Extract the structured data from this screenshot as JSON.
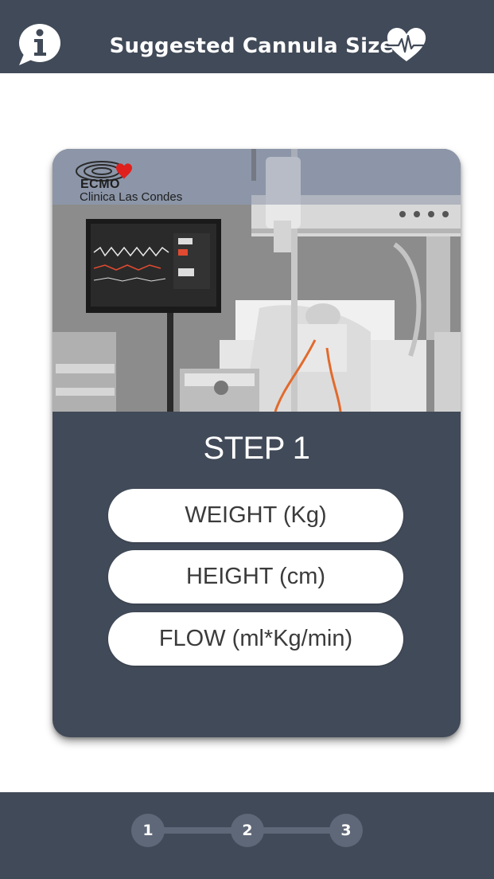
{
  "header": {
    "title": "Suggested Cannula Size",
    "info_icon": "info-icon",
    "heart_icon": "heart-pulse-icon"
  },
  "card": {
    "photo": {
      "logo_ecmo": "ECMO",
      "logo_text": "Clinica Las Condes"
    },
    "step_title": "STEP 1",
    "fields": [
      {
        "label": "WEIGHT (Kg)"
      },
      {
        "label": "HEIGHT (cm)"
      },
      {
        "label": "FLOW (ml*Kg/min)"
      }
    ]
  },
  "stepper": {
    "steps": [
      {
        "label": "1"
      },
      {
        "label": "2"
      },
      {
        "label": "3"
      }
    ]
  },
  "colors": {
    "primary": "#414a58",
    "stepper": "#5f6878",
    "button_bg": "#ffffff",
    "logo_heart": "#e0201c"
  }
}
